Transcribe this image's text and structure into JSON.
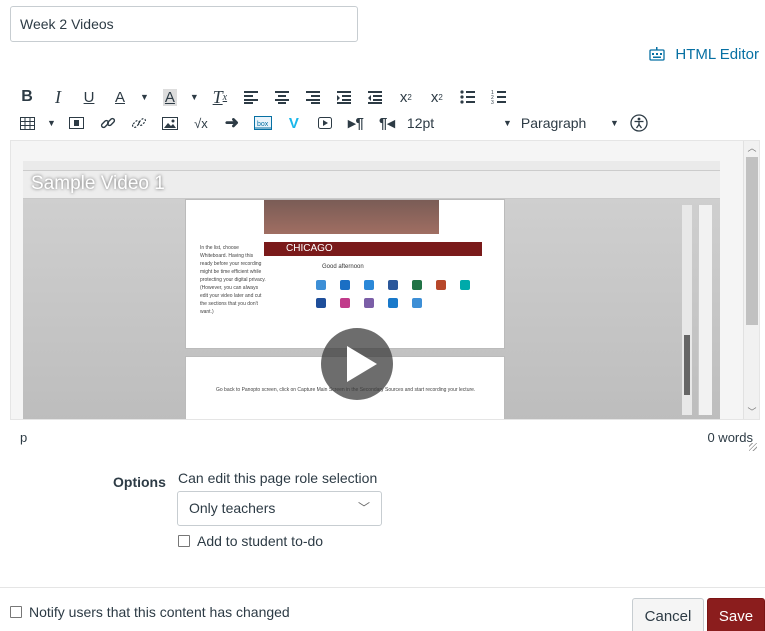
{
  "page": {
    "title_value": "Week 2 Videos"
  },
  "editor": {
    "html_editor_label": "HTML Editor",
    "font_size": "12pt",
    "block_format": "Paragraph",
    "status_path": "p",
    "word_count": "0 words",
    "video": {
      "title": "Sample Video 1",
      "doc_text_1": "In the list, choose Whiteboard. Having this ready before your recording might be time efficient while protecting your digital privacy. (However, you can always edit your video later and cut the sections that you don't want.)",
      "doc_text_2": "Go back to Panopto screen, click on Capture Main Screen in the Secondary Sources and start recording your lecture.",
      "doc_banner": "CHICAGO",
      "doc_greeting": "Good afternoon"
    }
  },
  "options": {
    "label": "Options",
    "role_heading": "Can edit this page role selection",
    "role_value": "Only teachers",
    "todo_label": "Add to student to-do"
  },
  "footer": {
    "notify_label": "Notify users that this content has changed",
    "cancel_label": "Cancel",
    "save_label": "Save"
  },
  "colors": {
    "link": "#0770a3",
    "save_bg": "#8b1d1d",
    "text": "#2d3b45"
  }
}
